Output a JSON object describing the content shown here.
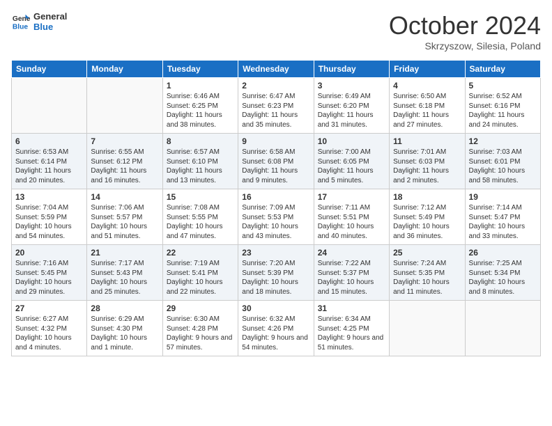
{
  "header": {
    "logo_line1": "General",
    "logo_line2": "Blue",
    "month": "October 2024",
    "location": "Skrzyszow, Silesia, Poland"
  },
  "days_of_week": [
    "Sunday",
    "Monday",
    "Tuesday",
    "Wednesday",
    "Thursday",
    "Friday",
    "Saturday"
  ],
  "weeks": [
    [
      {
        "num": "",
        "detail": ""
      },
      {
        "num": "",
        "detail": ""
      },
      {
        "num": "1",
        "detail": "Sunrise: 6:46 AM\nSunset: 6:25 PM\nDaylight: 11 hours and 38 minutes."
      },
      {
        "num": "2",
        "detail": "Sunrise: 6:47 AM\nSunset: 6:23 PM\nDaylight: 11 hours and 35 minutes."
      },
      {
        "num": "3",
        "detail": "Sunrise: 6:49 AM\nSunset: 6:20 PM\nDaylight: 11 hours and 31 minutes."
      },
      {
        "num": "4",
        "detail": "Sunrise: 6:50 AM\nSunset: 6:18 PM\nDaylight: 11 hours and 27 minutes."
      },
      {
        "num": "5",
        "detail": "Sunrise: 6:52 AM\nSunset: 6:16 PM\nDaylight: 11 hours and 24 minutes."
      }
    ],
    [
      {
        "num": "6",
        "detail": "Sunrise: 6:53 AM\nSunset: 6:14 PM\nDaylight: 11 hours and 20 minutes."
      },
      {
        "num": "7",
        "detail": "Sunrise: 6:55 AM\nSunset: 6:12 PM\nDaylight: 11 hours and 16 minutes."
      },
      {
        "num": "8",
        "detail": "Sunrise: 6:57 AM\nSunset: 6:10 PM\nDaylight: 11 hours and 13 minutes."
      },
      {
        "num": "9",
        "detail": "Sunrise: 6:58 AM\nSunset: 6:08 PM\nDaylight: 11 hours and 9 minutes."
      },
      {
        "num": "10",
        "detail": "Sunrise: 7:00 AM\nSunset: 6:05 PM\nDaylight: 11 hours and 5 minutes."
      },
      {
        "num": "11",
        "detail": "Sunrise: 7:01 AM\nSunset: 6:03 PM\nDaylight: 11 hours and 2 minutes."
      },
      {
        "num": "12",
        "detail": "Sunrise: 7:03 AM\nSunset: 6:01 PM\nDaylight: 10 hours and 58 minutes."
      }
    ],
    [
      {
        "num": "13",
        "detail": "Sunrise: 7:04 AM\nSunset: 5:59 PM\nDaylight: 10 hours and 54 minutes."
      },
      {
        "num": "14",
        "detail": "Sunrise: 7:06 AM\nSunset: 5:57 PM\nDaylight: 10 hours and 51 minutes."
      },
      {
        "num": "15",
        "detail": "Sunrise: 7:08 AM\nSunset: 5:55 PM\nDaylight: 10 hours and 47 minutes."
      },
      {
        "num": "16",
        "detail": "Sunrise: 7:09 AM\nSunset: 5:53 PM\nDaylight: 10 hours and 43 minutes."
      },
      {
        "num": "17",
        "detail": "Sunrise: 7:11 AM\nSunset: 5:51 PM\nDaylight: 10 hours and 40 minutes."
      },
      {
        "num": "18",
        "detail": "Sunrise: 7:12 AM\nSunset: 5:49 PM\nDaylight: 10 hours and 36 minutes."
      },
      {
        "num": "19",
        "detail": "Sunrise: 7:14 AM\nSunset: 5:47 PM\nDaylight: 10 hours and 33 minutes."
      }
    ],
    [
      {
        "num": "20",
        "detail": "Sunrise: 7:16 AM\nSunset: 5:45 PM\nDaylight: 10 hours and 29 minutes."
      },
      {
        "num": "21",
        "detail": "Sunrise: 7:17 AM\nSunset: 5:43 PM\nDaylight: 10 hours and 25 minutes."
      },
      {
        "num": "22",
        "detail": "Sunrise: 7:19 AM\nSunset: 5:41 PM\nDaylight: 10 hours and 22 minutes."
      },
      {
        "num": "23",
        "detail": "Sunrise: 7:20 AM\nSunset: 5:39 PM\nDaylight: 10 hours and 18 minutes."
      },
      {
        "num": "24",
        "detail": "Sunrise: 7:22 AM\nSunset: 5:37 PM\nDaylight: 10 hours and 15 minutes."
      },
      {
        "num": "25",
        "detail": "Sunrise: 7:24 AM\nSunset: 5:35 PM\nDaylight: 10 hours and 11 minutes."
      },
      {
        "num": "26",
        "detail": "Sunrise: 7:25 AM\nSunset: 5:34 PM\nDaylight: 10 hours and 8 minutes."
      }
    ],
    [
      {
        "num": "27",
        "detail": "Sunrise: 6:27 AM\nSunset: 4:32 PM\nDaylight: 10 hours and 4 minutes."
      },
      {
        "num": "28",
        "detail": "Sunrise: 6:29 AM\nSunset: 4:30 PM\nDaylight: 10 hours and 1 minute."
      },
      {
        "num": "29",
        "detail": "Sunrise: 6:30 AM\nSunset: 4:28 PM\nDaylight: 9 hours and 57 minutes."
      },
      {
        "num": "30",
        "detail": "Sunrise: 6:32 AM\nSunset: 4:26 PM\nDaylight: 9 hours and 54 minutes."
      },
      {
        "num": "31",
        "detail": "Sunrise: 6:34 AM\nSunset: 4:25 PM\nDaylight: 9 hours and 51 minutes."
      },
      {
        "num": "",
        "detail": ""
      },
      {
        "num": "",
        "detail": ""
      }
    ]
  ]
}
